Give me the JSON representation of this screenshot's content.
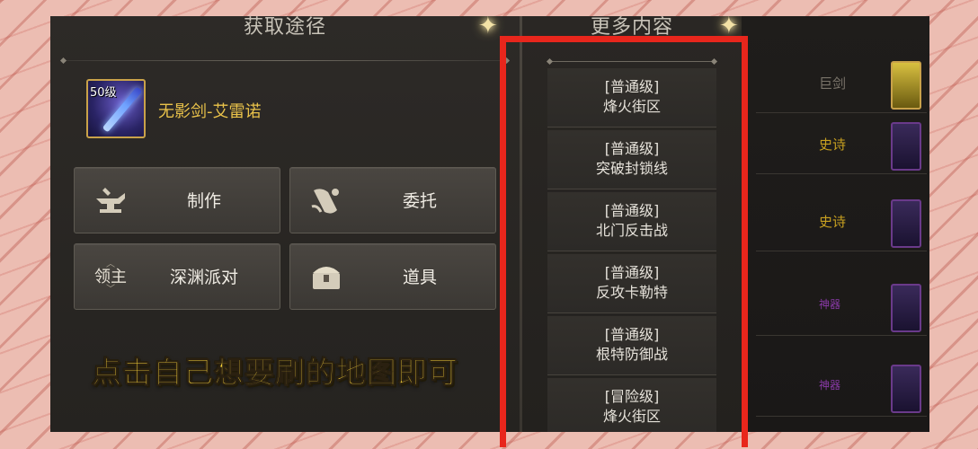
{
  "acquire_panel": {
    "title": "获取途径",
    "item": {
      "level_badge": "50级",
      "name": "无影剑-艾雷诺"
    },
    "buttons": [
      {
        "label": "制作",
        "icon": "anvil-icon"
      },
      {
        "label": "委托",
        "icon": "scroll-icon"
      },
      {
        "label": "深渊派对",
        "icon_text": "领主"
      },
      {
        "label": "道具",
        "icon": "chest-icon"
      }
    ]
  },
  "more_panel": {
    "title": "更多内容",
    "maps": [
      {
        "grade": "[普通级]",
        "name": "烽火街区"
      },
      {
        "grade": "[普通级]",
        "name": "突破封锁线"
      },
      {
        "grade": "[普通级]",
        "name": "北门反击战"
      },
      {
        "grade": "[普通级]",
        "name": "反攻卡勒特"
      },
      {
        "grade": "[普通级]",
        "name": "根特防御战"
      },
      {
        "grade": "[冒险级]",
        "name": "烽火街区"
      }
    ]
  },
  "right_panel": {
    "rows": [
      {
        "text": "巨剑"
      },
      {
        "text": "史诗"
      },
      {
        "text": "史诗"
      },
      {
        "text": "神器"
      },
      {
        "text": "神器"
      }
    ]
  },
  "caption": "点击自己想要刷的地图即可",
  "colors": {
    "highlight_frame": "#e8261c",
    "caption": "#f6d23a",
    "item_name": "#e9c24a"
  }
}
